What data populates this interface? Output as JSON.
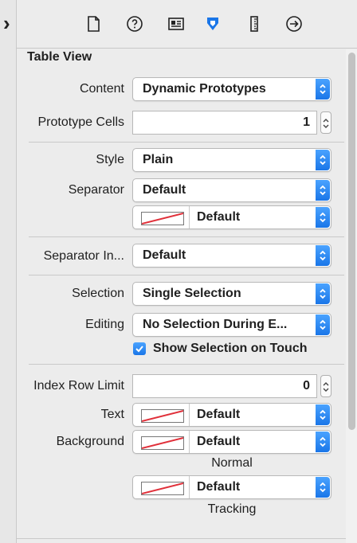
{
  "panel": {
    "title": "Table View"
  },
  "rows": {
    "content": {
      "label": "Content",
      "value": "Dynamic Prototypes"
    },
    "prototype_cells": {
      "label": "Prototype Cells",
      "value": "1"
    },
    "style": {
      "label": "Style",
      "value": "Plain"
    },
    "separator": {
      "label": "Separator",
      "value": "Default"
    },
    "separator_color": {
      "value": "Default"
    },
    "separator_inset": {
      "label": "Separator In...",
      "value": "Default"
    },
    "selection": {
      "label": "Selection",
      "value": "Single Selection"
    },
    "editing": {
      "label": "Editing",
      "value": "No Selection During E..."
    },
    "show_selection": {
      "label": "Show Selection on Touch",
      "checked": true
    },
    "index_row_limit": {
      "label": "Index Row Limit",
      "value": "0"
    },
    "text": {
      "label": "Text",
      "value": "Default"
    },
    "background": {
      "label": "Background",
      "value": "Default",
      "caption": "Normal"
    },
    "tracking": {
      "value": "Default",
      "caption": "Tracking"
    }
  },
  "toolbar_icons": [
    "file-icon",
    "help-icon",
    "identity-icon",
    "attributes-icon",
    "size-icon",
    "connections-icon"
  ],
  "colors": {
    "accent": "#1a76e8",
    "swatch_line": "#e0303a"
  }
}
